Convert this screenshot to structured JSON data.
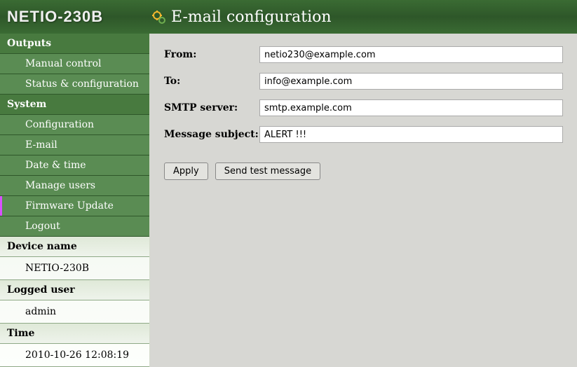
{
  "brand": "NETIO-230B",
  "page_title": "E-mail configuration",
  "sidebar": {
    "groups": [
      {
        "header": "Outputs",
        "items": [
          {
            "label": "Manual control"
          },
          {
            "label": "Status & configuration"
          }
        ]
      },
      {
        "header": "System",
        "items": [
          {
            "label": "Configuration"
          },
          {
            "label": "E-mail"
          },
          {
            "label": "Date & time"
          },
          {
            "label": "Manage users"
          },
          {
            "label": "Firmware Update"
          },
          {
            "label": "Logout"
          }
        ]
      }
    ],
    "info": [
      {
        "header": "Device name",
        "value": "NETIO-230B"
      },
      {
        "header": "Logged user",
        "value": "admin"
      },
      {
        "header": "Time",
        "value": "2010-10-26 12:08:19"
      }
    ]
  },
  "form": {
    "from_label": "From:",
    "from_value": "netio230@example.com",
    "to_label": "To:",
    "to_value": "info@example.com",
    "smtp_label": "SMTP server:",
    "smtp_value": "smtp.example.com",
    "subject_label": "Message subject:",
    "subject_value": "ALERT !!!"
  },
  "buttons": {
    "apply": "Apply",
    "send_test": "Send test message"
  }
}
